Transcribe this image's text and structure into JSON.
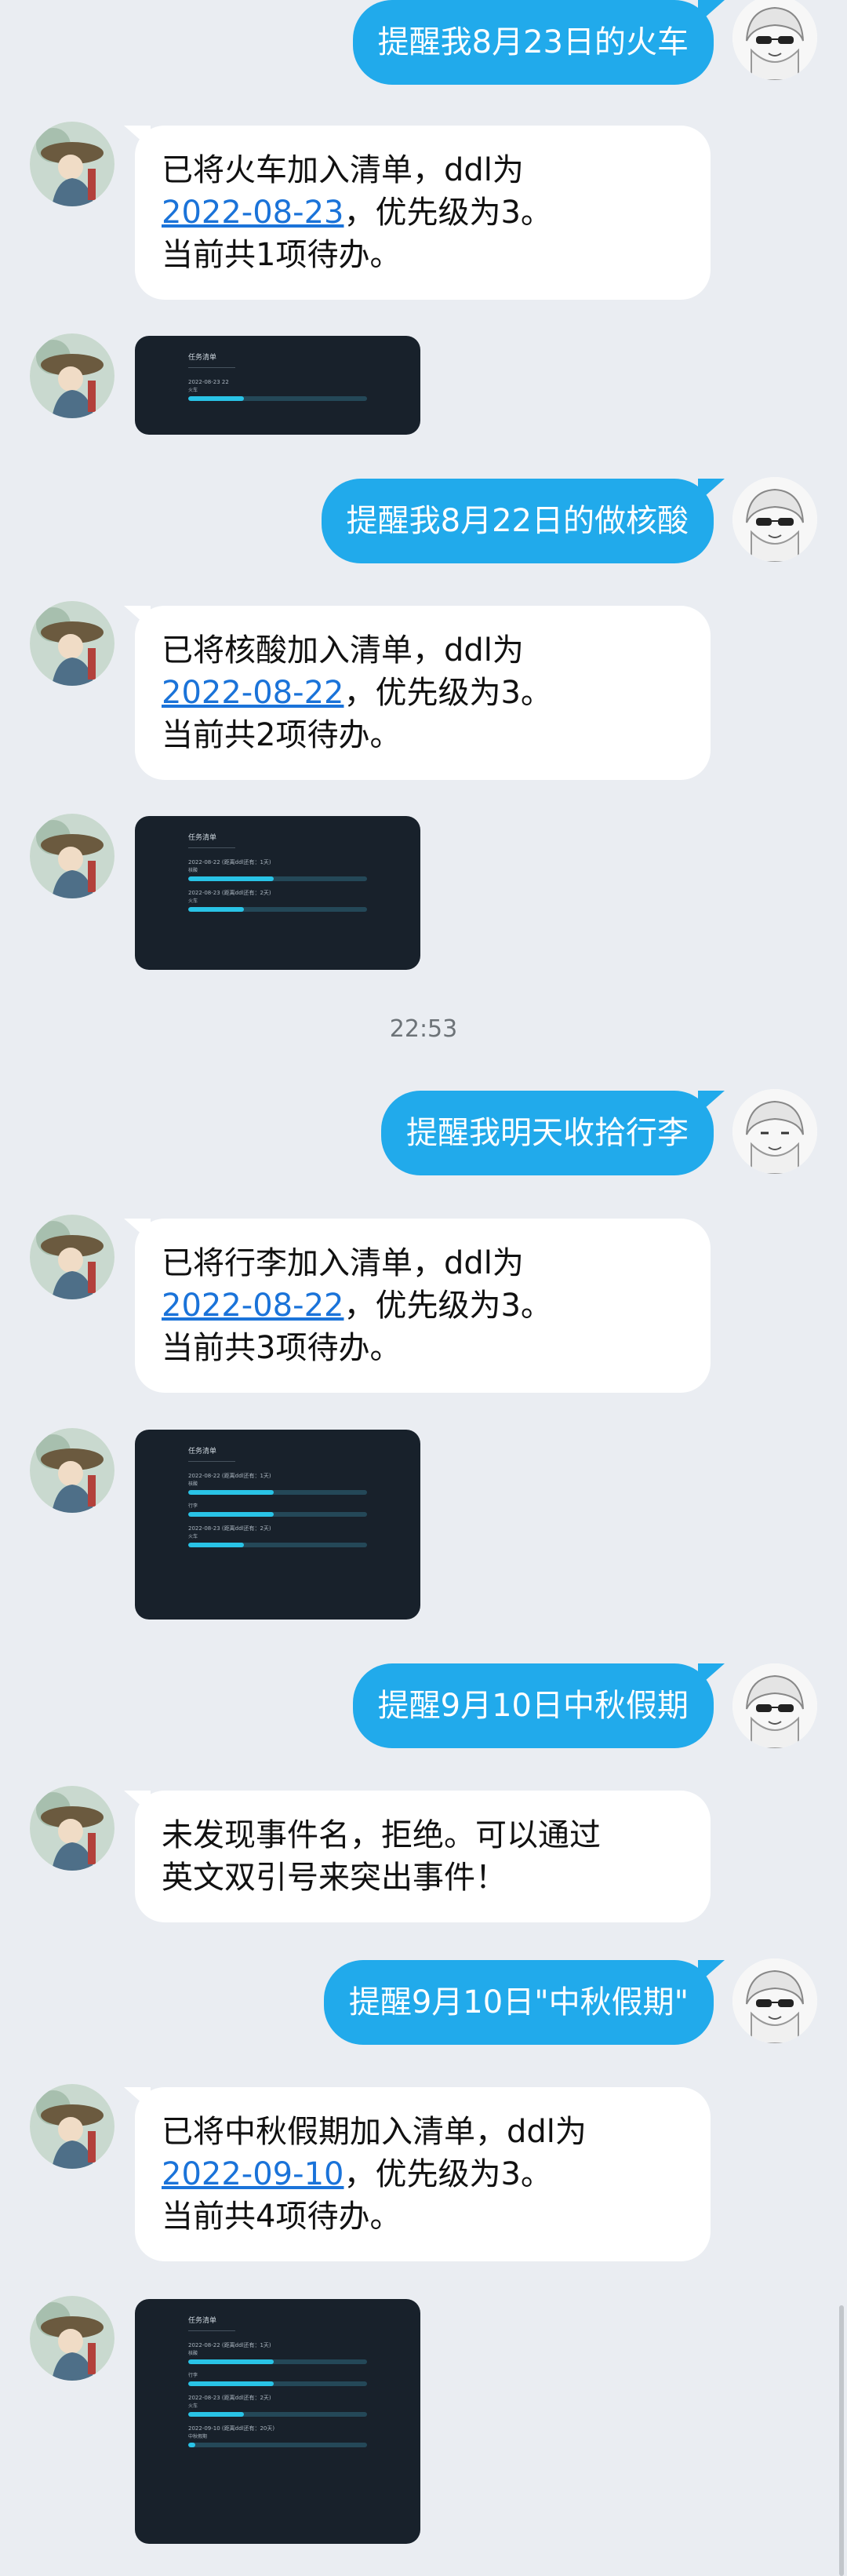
{
  "time_divider": "22:53",
  "messages": [
    {
      "text": "提醒我8月23日的火车"
    },
    {
      "pre": "已将火车加入清单，ddl为",
      "date": "2022-08-23",
      "post": "，优先级为3。",
      "line3": "当前共1项待办。"
    },
    {
      "text": "提醒我8月22日的做核酸"
    },
    {
      "pre": "已将核酸加入清单，ddl为",
      "date": "2022-08-22",
      "post": "，优先级为3。",
      "line3": "当前共2项待办。"
    },
    {
      "text": "提醒我明天收拾行李"
    },
    {
      "pre": "已将行李加入清单，ddl为",
      "date": "2022-08-22",
      "post": "，优先级为3。",
      "line3": "当前共3项待办。"
    },
    {
      "text": "提醒9月10日中秋假期"
    },
    {
      "line1": "未发现事件名，拒绝。可以通过",
      "line2": "英文双引号来突出事件！"
    },
    {
      "text": "提醒9月10日\"中秋假期\""
    },
    {
      "pre": "已将中秋假期加入清单，ddl为",
      "date": "2022-09-10",
      "post": "，优先级为3。",
      "line3": "当前共4项待办。"
    }
  ],
  "cards": [
    {
      "title": "任务清单",
      "tasks": [
        {
          "meta": "2022-08-23 22",
          "name": "火车",
          "progress": 0.31
        }
      ]
    },
    {
      "title": "任务清单",
      "tasks": [
        {
          "meta": "2022-08-22 (距离ddl还有：1天)",
          "name": "核酸",
          "progress": 0.48
        },
        {
          "meta": "2022-08-23 (距离ddl还有：2天)",
          "name": "火车",
          "progress": 0.31
        }
      ]
    },
    {
      "title": "任务清单",
      "tasks": [
        {
          "meta": "2022-08-22 (距离ddl还有：1天)",
          "name": "核酸",
          "progress": 0.48
        },
        {
          "meta": "",
          "name": "行李",
          "progress": 0.48
        },
        {
          "meta": "2022-08-23 (距离ddl还有：2天)",
          "name": "火车",
          "progress": 0.31
        }
      ]
    },
    {
      "title": "任务清单",
      "tasks": [
        {
          "meta": "2022-08-22 (距离ddl还有：1天)",
          "name": "核酸",
          "progress": 0.48
        },
        {
          "meta": "",
          "name": "行李",
          "progress": 0.48
        },
        {
          "meta": "2022-08-23 (距离ddl还有：2天)",
          "name": "火车",
          "progress": 0.31
        },
        {
          "meta": "2022-09-10 (距离ddl还有：20天)",
          "name": "中秋假期",
          "progress": 0.04
        }
      ]
    }
  ],
  "colors": {
    "background": "#eaedf2",
    "outgoing_bubble": "#21aaeb",
    "incoming_bubble": "#ffffff",
    "link": "#1a73d9",
    "card_bg": "#18212b",
    "progress_fill": "#29c3e6"
  }
}
